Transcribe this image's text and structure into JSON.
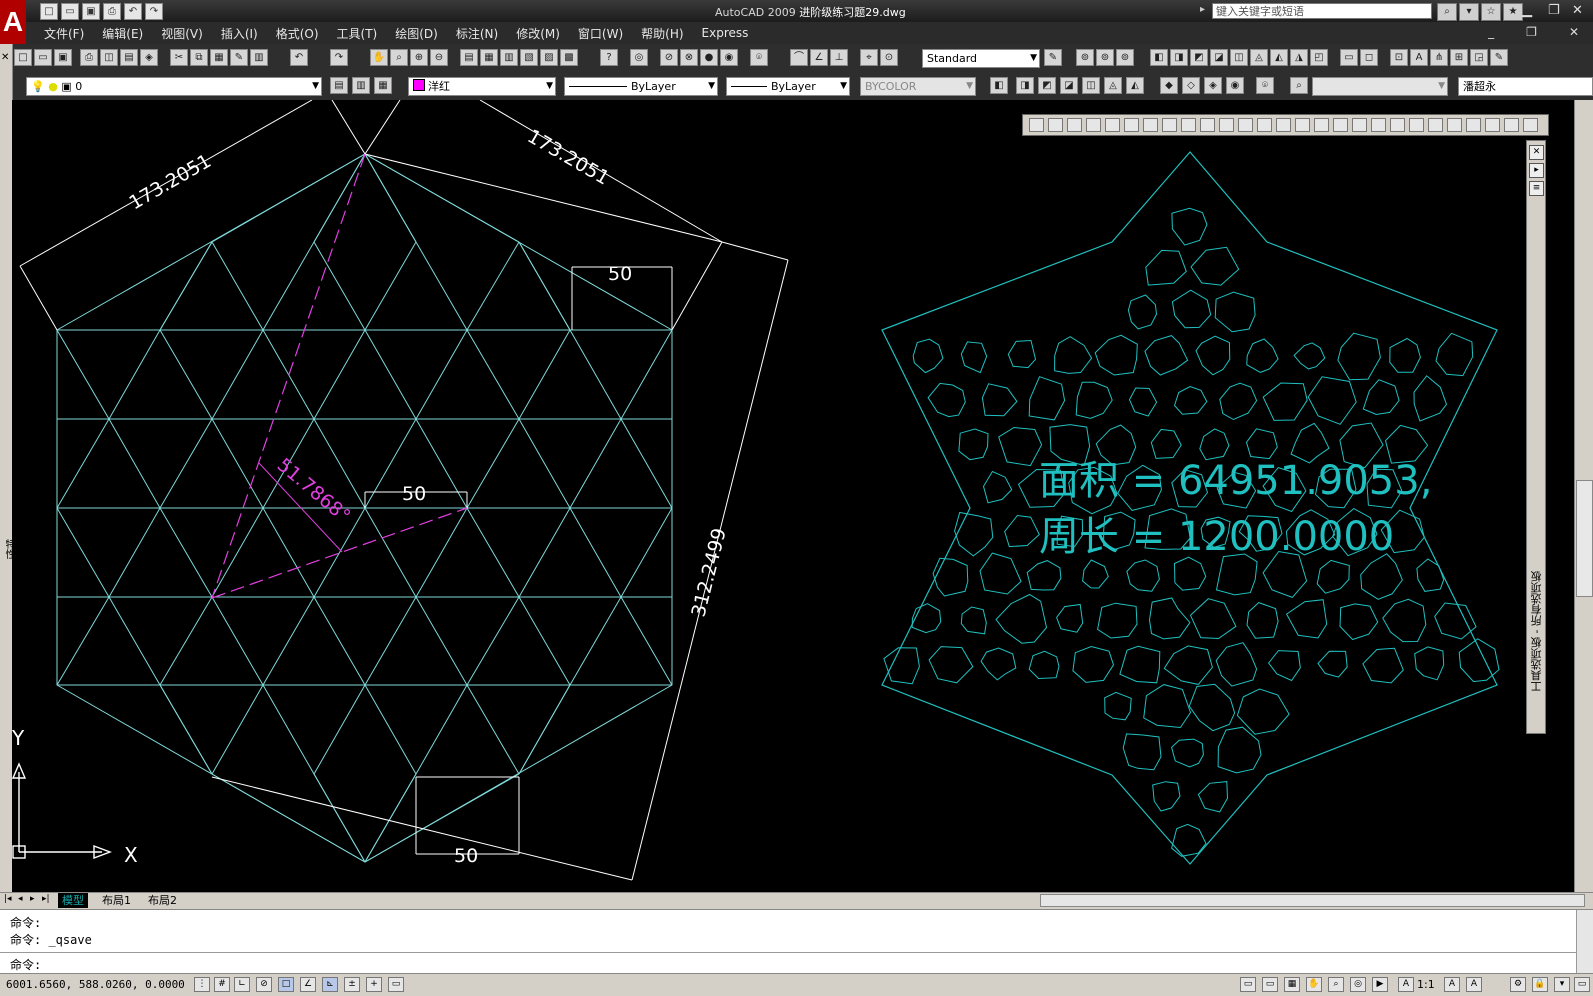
{
  "app": {
    "title": "AutoCAD 2009",
    "document": "进阶级练习题29.dwg",
    "search_placeholder": "键入关键字或短语",
    "brand_color": "#b00000"
  },
  "menu": [
    "文件(F)",
    "编辑(E)",
    "视图(V)",
    "插入(I)",
    "格式(O)",
    "工具(T)",
    "绘图(D)",
    "标注(N)",
    "修改(M)",
    "窗口(W)",
    "帮助(H)",
    "Express"
  ],
  "toolbar": {
    "text_style": "Standard",
    "layer": "0",
    "color": "洋红",
    "linetype": "ByLayer",
    "lineweight": "ByLayer",
    "plotstyle": "BYCOLOR",
    "user_combo": "潘超永"
  },
  "drawing": {
    "dim_top_left": "173.2051",
    "dim_top_right": "173.2051",
    "dim_right": "312.2499",
    "dim_angle": "51.7868°",
    "dim_width_top": "50",
    "dim_width_mid": "50",
    "dim_width_bottom": "50",
    "area_text": "面积 = 64951.9053,",
    "perimeter_text": "周长 = 1200.0000",
    "ucs_x": "X",
    "ucs_y": "Y",
    "line_color": "#7fd9d9",
    "dim_color": "#ffffff",
    "angle_color": "#e040e0",
    "star_color": "#20c0c0"
  },
  "side": {
    "left_label": "特性",
    "palette_label": "工具选项板 - 所有选项板"
  },
  "tabs": [
    "模型",
    "布局1",
    "布局2"
  ],
  "command": {
    "lines": [
      "命令:",
      "命令: _qsave"
    ],
    "prompt": "命令:"
  },
  "status": {
    "coords": "6001.6560, 588.0260, 0.0000",
    "scale": "1:1"
  }
}
